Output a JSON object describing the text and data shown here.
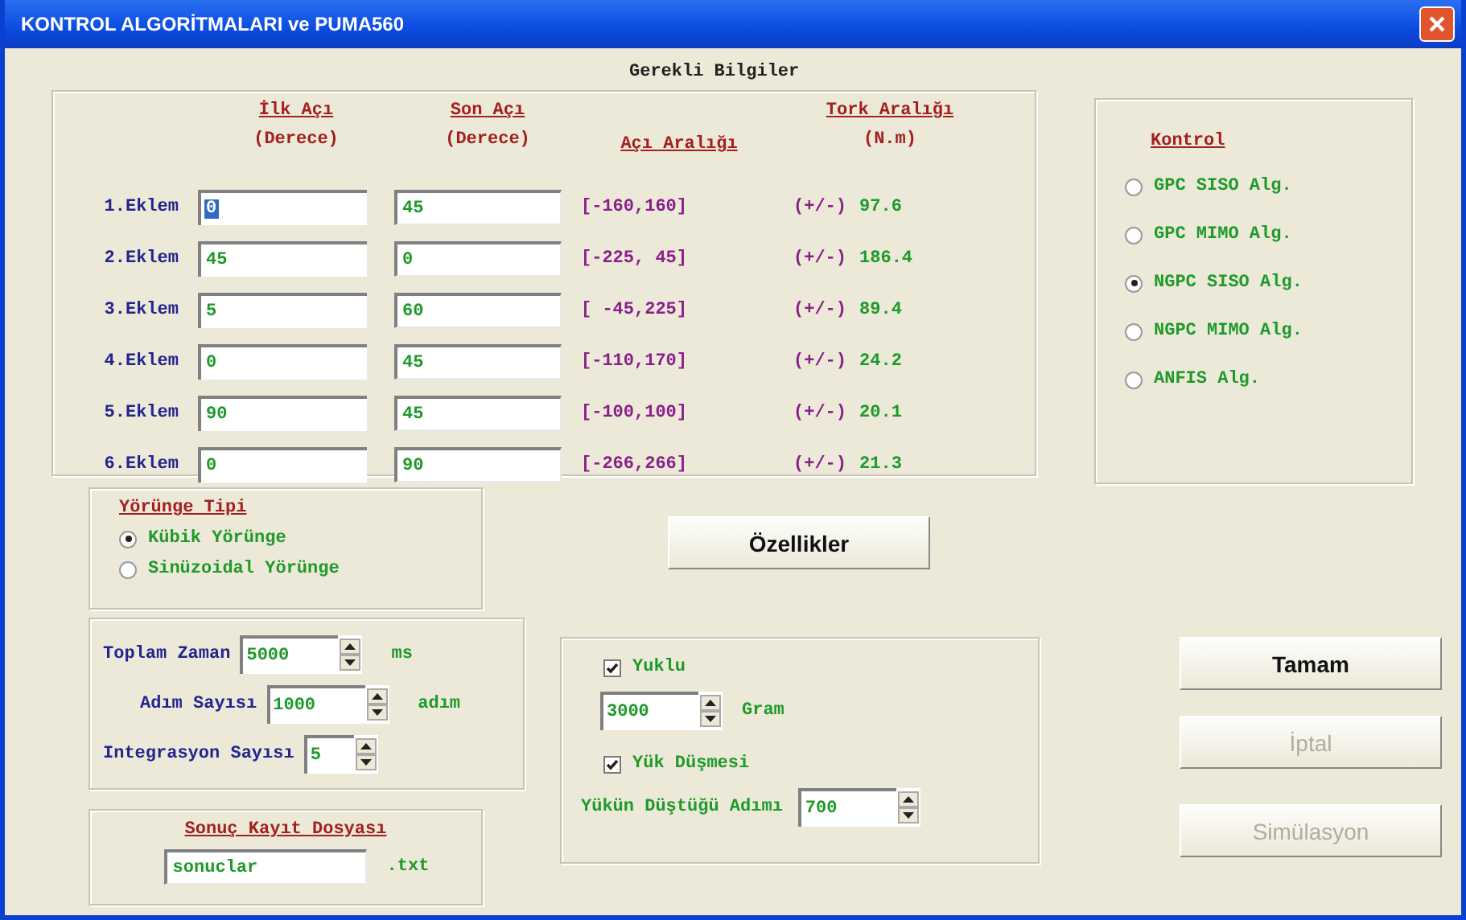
{
  "window": {
    "title": "KONTROL ALGORİTMALARI ve PUMA560"
  },
  "joints": {
    "title": "Gerekli Bilgiler",
    "headers": {
      "start": {
        "label": "İlk Açı",
        "unit": "(Derece)"
      },
      "end": {
        "label": "Son Açı",
        "unit": "(Derece)"
      },
      "range": {
        "label": "Açı Aralığı"
      },
      "torque": {
        "label": "Tork Aralığı",
        "unit": "(N.m)"
      }
    },
    "rows": [
      {
        "name": "1.Eklem",
        "start": "0",
        "start_highlighted": true,
        "end": "45",
        "range": "[-160,160]",
        "torque_sign": "(+/-)",
        "torque": "97.6"
      },
      {
        "name": "2.Eklem",
        "start": "45",
        "start_highlighted": false,
        "end": "0",
        "range": "[-225, 45]",
        "torque_sign": "(+/-)",
        "torque": "186.4"
      },
      {
        "name": "3.Eklem",
        "start": "5",
        "start_highlighted": false,
        "end": "60",
        "range": "[ -45,225]",
        "torque_sign": "(+/-)",
        "torque": "89.4"
      },
      {
        "name": "4.Eklem",
        "start": "0",
        "start_highlighted": false,
        "end": "45",
        "range": "[-110,170]",
        "torque_sign": "(+/-)",
        "torque": "24.2"
      },
      {
        "name": "5.Eklem",
        "start": "90",
        "start_highlighted": false,
        "end": "45",
        "range": "[-100,100]",
        "torque_sign": "(+/-)",
        "torque": "20.1"
      },
      {
        "name": "6.Eklem",
        "start": "0",
        "start_highlighted": false,
        "end": "90",
        "range": "[-266,266]",
        "torque_sign": "(+/-)",
        "torque": "21.3"
      }
    ]
  },
  "control": {
    "title": "Kontrol",
    "options": [
      {
        "label": "GPC SISO Alg.",
        "selected": false
      },
      {
        "label": "GPC MIMO Alg.",
        "selected": false
      },
      {
        "label": "NGPC SISO Alg.",
        "selected": true
      },
      {
        "label": "NGPC MIMO Alg.",
        "selected": false
      },
      {
        "label": "ANFIS Alg.",
        "selected": false
      }
    ]
  },
  "trajectory": {
    "title": "Yörünge Tipi",
    "options": [
      {
        "label": "Kübik Yörünge",
        "selected": true
      },
      {
        "label": "Sinüzoidal Yörünge",
        "selected": false
      }
    ]
  },
  "timing": [
    {
      "label": "Toplam Zaman",
      "value": "5000",
      "unit": "ms"
    },
    {
      "label": "Adım Sayısı",
      "value": "1000",
      "unit": "adım"
    },
    {
      "label": "Integrasyon Sayısı",
      "value": "5"
    }
  ],
  "result_file": {
    "title": "Sonuç Kayıt Dosyası",
    "value": "sonuclar",
    "extension": ".txt"
  },
  "properties_button": "Özellikler",
  "load": {
    "loaded": {
      "label": "Yuklu",
      "checked": true
    },
    "mass": {
      "value": "3000",
      "unit": "Gram"
    },
    "drop": {
      "label": "Yük Düşmesi",
      "checked": true
    },
    "drop_step": {
      "label": "Yükün Düştüğü Adımı",
      "value": "700"
    }
  },
  "buttons": [
    {
      "label": "Tamam",
      "disabled": false
    },
    {
      "label": "İptal",
      "disabled": true
    },
    {
      "label": "Simülasyon",
      "disabled": true
    }
  ]
}
